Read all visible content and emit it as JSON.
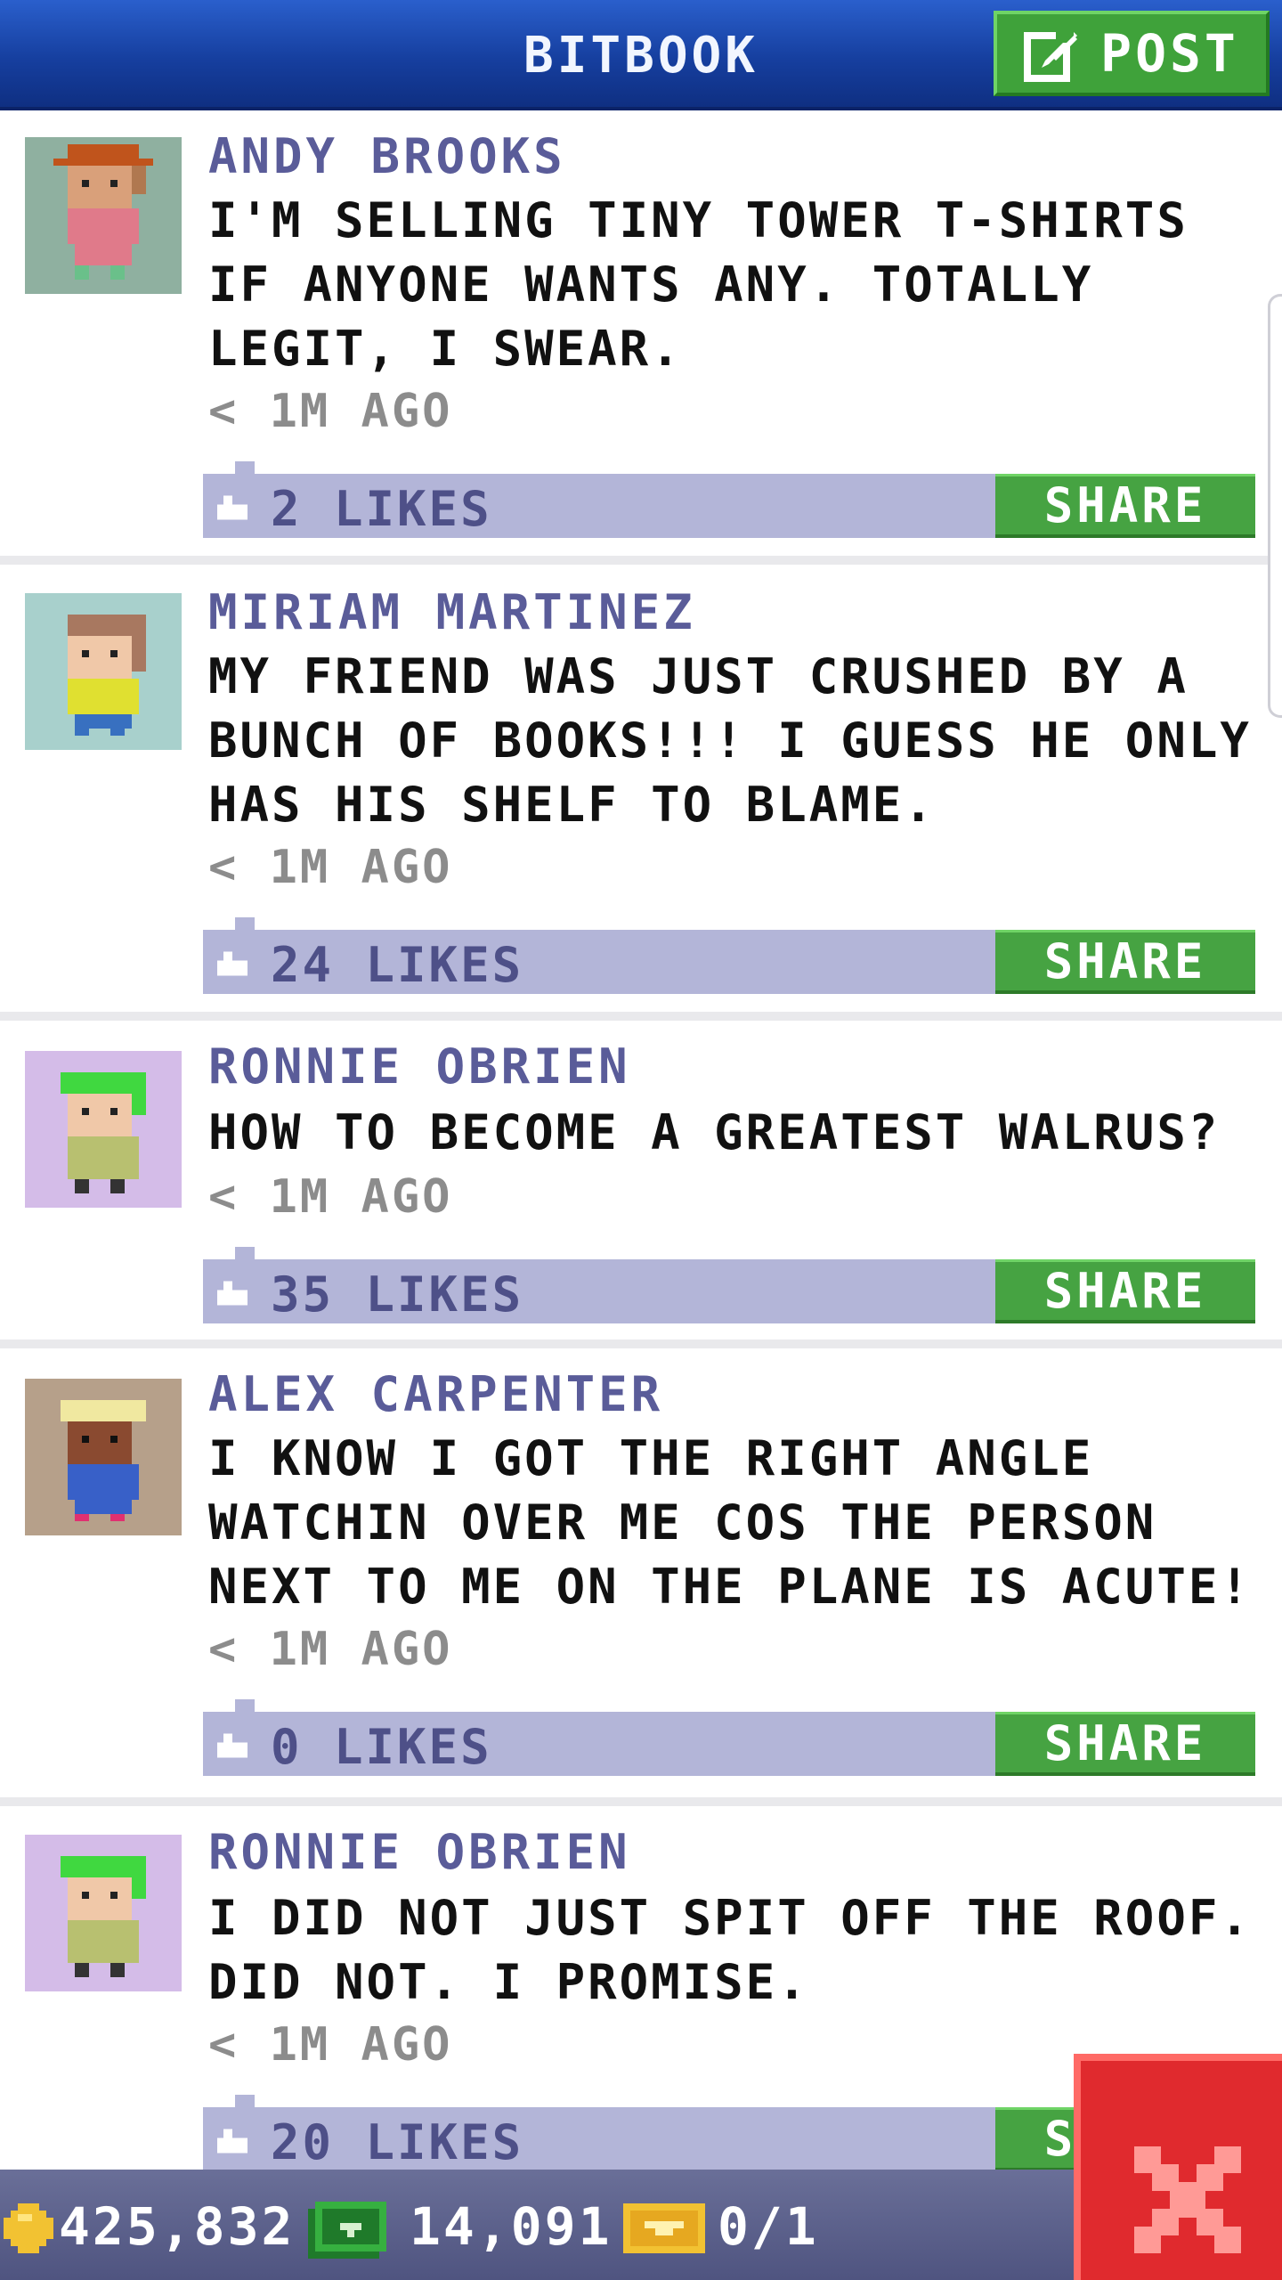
{
  "header": {
    "title": "BITBOOK",
    "post_label": "POST"
  },
  "posts": [
    {
      "name": "ANDY BROOKS",
      "message": "I'M SELLING TINY TOWER T-SHIRTS IF ANYONE WANTS ANY. TOTALLY LEGIT, I SWEAR.",
      "time": "< 1M AGO",
      "likes": "2 LIKES",
      "share_label": "SHARE",
      "avatar_bg": "#8fb0a0"
    },
    {
      "name": "MIRIAM MARTINEZ",
      "message": "MY FRIEND WAS JUST CRUSHED BY A BUNCH OF BOOKS!!! I GUESS HE ONLY HAS HIS SHELF TO BLAME.",
      "time": "< 1M AGO",
      "likes": "24 LIKES",
      "share_label": "SHARE",
      "avatar_bg": "#a8d0cc"
    },
    {
      "name": "RONNIE OBRIEN",
      "message": "HOW TO BECOME A GREATEST WALRUS?",
      "time": "< 1M AGO",
      "likes": "35 LIKES",
      "share_label": "SHARE",
      "avatar_bg": "#d4bce8"
    },
    {
      "name": "ALEX CARPENTER",
      "message": "I KNOW I GOT THE RIGHT ANGLE WATCHIN OVER ME COS THE PERSON NEXT TO ME ON THE PLANE IS ACUTE!",
      "time": "< 1M AGO",
      "likes": "0 LIKES",
      "share_label": "SHARE",
      "avatar_bg": "#b6a08a"
    },
    {
      "name": "RONNIE OBRIEN",
      "message": "I DID NOT JUST SPIT OFF THE ROOF. DID NOT. I PROMISE.",
      "time": "< 1M AGO",
      "likes": "20 LIKES",
      "share_label": "SHARE",
      "avatar_bg": "#d4bce8"
    }
  ],
  "status": {
    "coins": "425,832",
    "bux": "14,091",
    "tickets": "0/1"
  },
  "colors": {
    "header_blue": "#163f9f",
    "accent_green": "#46a342",
    "name_purple": "#5a5c99",
    "like_bar": "#b3b5d8",
    "close_red": "#e02a2e"
  },
  "icons": [
    "post-edit-icon",
    "like-icon",
    "coin-icon",
    "cash-icon",
    "ticket-icon",
    "close-icon"
  ]
}
